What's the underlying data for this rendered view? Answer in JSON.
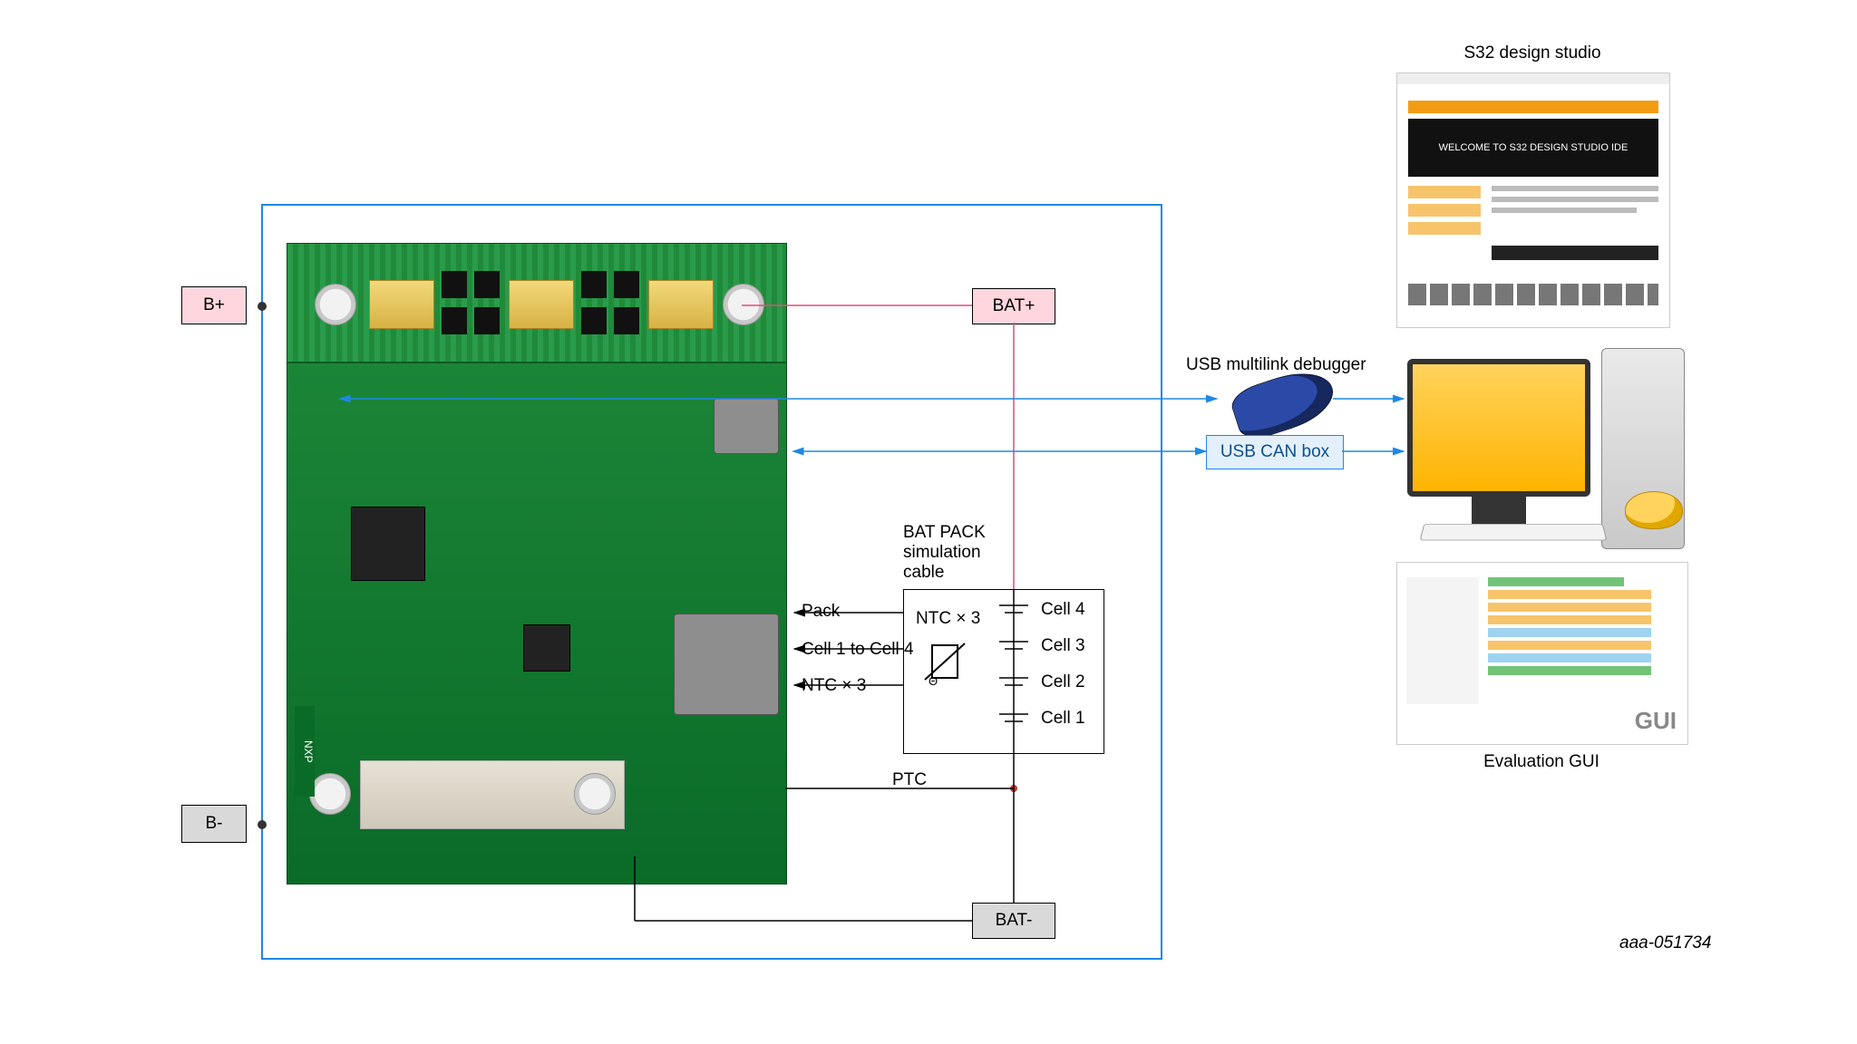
{
  "frame": {
    "border": "#1976d2"
  },
  "terminals": {
    "bplus": "B+",
    "bminus": "B-"
  },
  "bat": {
    "plus": "BAT+",
    "minus": "BAT-"
  },
  "batpack": {
    "title": "BAT PACK\nsimulation\ncable",
    "pack": "Pack",
    "cells": "Cell 1 to Cell 4",
    "ntc": "NTC × 3",
    "emt_ntc": "NTC × 3",
    "c1": "Cell 1",
    "c2": "Cell 2",
    "c3": "Cell 3",
    "c4": "Cell 4"
  },
  "ptc": "PTC",
  "right": {
    "s32": "S32 design studio",
    "ide_welcome": "WELCOME TO S32 DESIGN STUDIO IDE",
    "usb_debug": "USB multilink debugger",
    "canbox": "USB CAN box",
    "eval_gui": "Evaluation GUI",
    "gui": "GUI"
  },
  "docid": "aaa-051734",
  "colors": {
    "blue": "#1e88e5",
    "pink": "#e64a7a",
    "pinkfill": "#ffd6de",
    "gray": "#d9d9d9"
  }
}
